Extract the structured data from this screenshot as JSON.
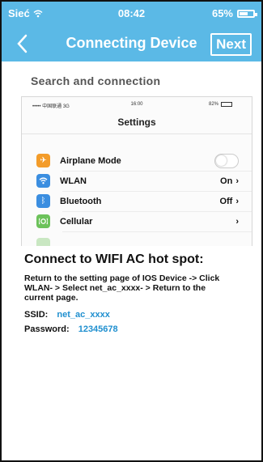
{
  "status_bar": {
    "carrier": "Sieć",
    "time": "08:42",
    "battery": "65%",
    "battery_level": 0.65
  },
  "header": {
    "title": "Connecting Device",
    "next_label": "Next"
  },
  "section": {
    "title": "Search and connection"
  },
  "phone_screenshot": {
    "status_left": "••••• 中国联通 3G",
    "status_time": "16:00",
    "status_right": "82%",
    "title": "Settings",
    "rows": [
      {
        "label": "Airplane Mode",
        "value": "",
        "icon": "airplane-icon",
        "color": "#f39c2a"
      },
      {
        "label": "WLAN",
        "value": "On",
        "icon": "wifi-icon",
        "color": "#3b8ee0"
      },
      {
        "label": "Bluetooth",
        "value": "Off",
        "icon": "bluetooth-icon",
        "color": "#3b8ee0"
      },
      {
        "label": "Cellular",
        "value": "",
        "icon": "cellular-icon",
        "color": "#6cc25a"
      }
    ]
  },
  "instructions": {
    "heading": "Connect to WIFI AC hot spot:",
    "description": "Return to the setting page of IOS Device -> Click WLAN- > Select net_ac_xxxx- > Return to the current page.",
    "ssid_label": "SSID:",
    "ssid_value": "net_ac_xxxx",
    "password_label": "Password:",
    "password_value": "12345678"
  },
  "colors": {
    "accent": "#5bb9e6",
    "link": "#1f8fcf"
  }
}
